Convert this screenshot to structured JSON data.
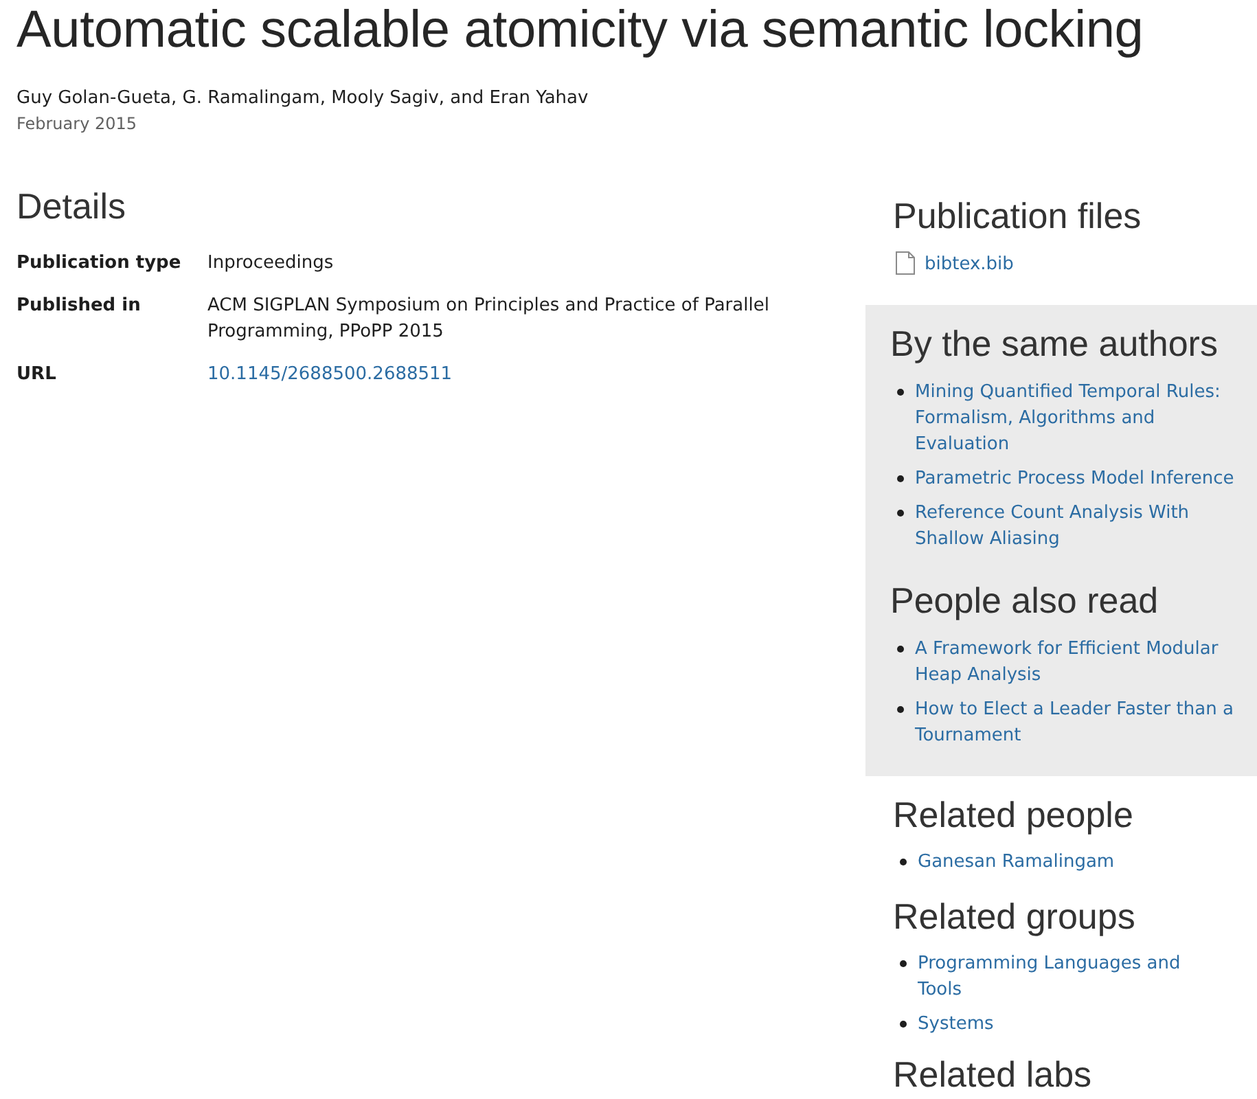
{
  "title": "Automatic scalable atomicity via semantic locking",
  "authors": "Guy Golan-Gueta, G. Ramalingam, Mooly Sagiv, and Eran Yahav",
  "date": "February 2015",
  "details": {
    "heading": "Details",
    "rows": [
      {
        "label": "Publication type",
        "value": "Inproceedings",
        "kind": "text"
      },
      {
        "label": "Published in",
        "value": "ACM SIGPLAN Symposium on Principles and Practice of Parallel Programming, PPoPP 2015",
        "kind": "text"
      },
      {
        "label": "URL",
        "value": "10.1145/2688500.2688511",
        "kind": "link"
      }
    ]
  },
  "sidebar": {
    "sections": [
      {
        "heading": "Publication files",
        "kind": "files",
        "shaded": false,
        "items": [
          "bibtex.bib"
        ]
      },
      {
        "heading": "By the same authors",
        "kind": "links",
        "shaded": true,
        "items": [
          "Mining Quantified Temporal Rules: Formalism, Algorithms and Evaluation",
          "Parametric Process Model Inference",
          "Reference Count Analysis With Shallow Aliasing"
        ]
      },
      {
        "heading": "People also read",
        "kind": "links",
        "shaded": true,
        "items": [
          "A Framework for Efficient Modular Heap Analysis",
          "How to Elect a Leader Faster than a Tournament"
        ]
      },
      {
        "heading": "Related people",
        "kind": "links",
        "shaded": false,
        "items": [
          "Ganesan Ramalingam"
        ]
      },
      {
        "heading": "Related groups",
        "kind": "links",
        "shaded": false,
        "items": [
          "Programming Languages and Tools",
          "Systems"
        ]
      },
      {
        "heading": "Related labs",
        "shaded": false
      }
    ]
  }
}
